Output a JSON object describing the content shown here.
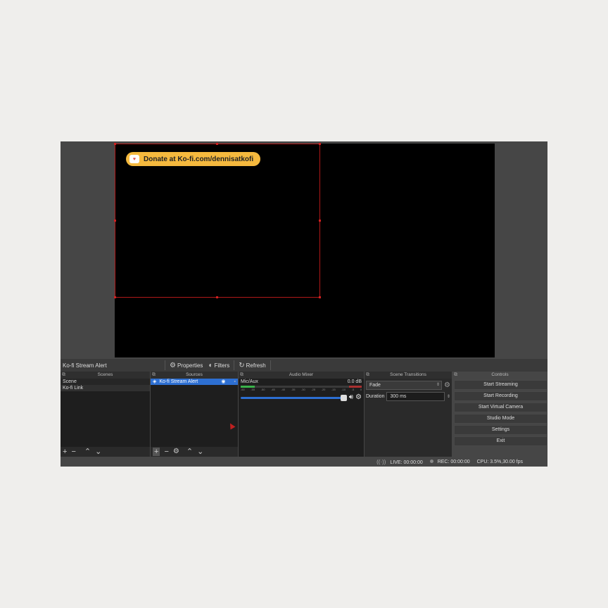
{
  "overlay": {
    "kofi_text": "Donate at Ko-fi.com/dennisatkofi",
    "kofi_icon": "kofi-cup-icon"
  },
  "toolbar": {
    "source_name": "Ko-fi Stream Alert",
    "properties_label": "Properties",
    "filters_label": "Filters",
    "refresh_label": "Refresh"
  },
  "scenes": {
    "title": "Scenes",
    "items": [
      "Scene",
      "Ko-fi Link"
    ]
  },
  "sources": {
    "title": "Sources",
    "items": [
      "Ko-fi Stream Alert"
    ]
  },
  "mixer": {
    "title": "Audio Mixer",
    "channel": "Mic/Aux",
    "db": "0.0 dB",
    "ticks": [
      "-60",
      "-55",
      "-50",
      "-45",
      "-40",
      "-35",
      "-30",
      "-25",
      "-20",
      "-15",
      "-10",
      "-5",
      "0"
    ]
  },
  "transitions": {
    "title": "Scene Transitions",
    "selected": "Fade",
    "duration_label": "Duration",
    "duration_value": "300 ms"
  },
  "controls": {
    "title": "Controls",
    "buttons": [
      "Start Streaming",
      "Start Recording",
      "Start Virtual Camera",
      "Studio Mode",
      "Settings",
      "Exit"
    ]
  },
  "status": {
    "live": "LIVE: 00:00:00",
    "rec": "REC: 00:00:00",
    "cpu": "CPU: 3.5%,30.00 fps"
  },
  "colors": {
    "accent": "#2d6fd2",
    "kofi_pill": "#f5b93e",
    "selection": "#b01818"
  }
}
